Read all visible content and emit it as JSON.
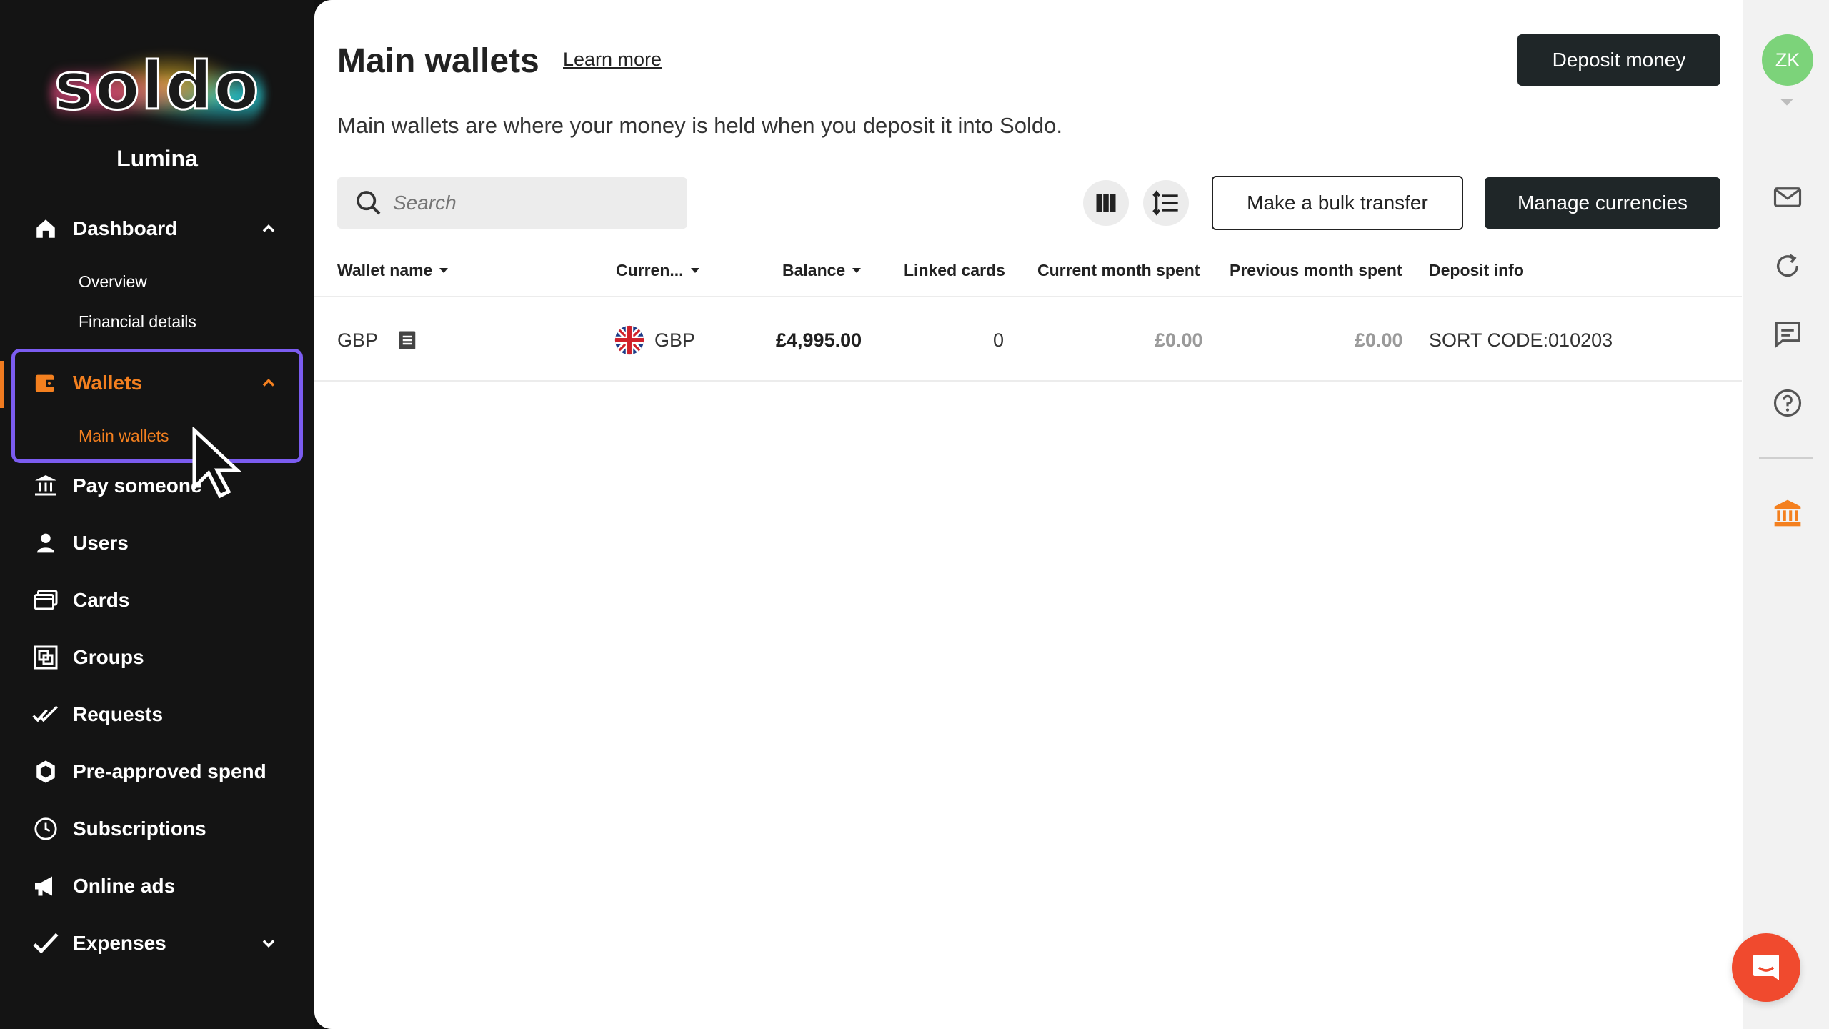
{
  "sidebar": {
    "logo_text": "soldo",
    "company_name": "Lumina",
    "nav": [
      {
        "label": "Dashboard",
        "icon": "home-icon",
        "expanded": true
      },
      {
        "label": "Wallets",
        "icon": "wallet-icon",
        "expanded": true,
        "active": true
      },
      {
        "label": "Pay someone",
        "icon": "bank-transfer-icon"
      },
      {
        "label": "Users",
        "icon": "user-icon"
      },
      {
        "label": "Cards",
        "icon": "cards-icon"
      },
      {
        "label": "Groups",
        "icon": "groups-icon"
      },
      {
        "label": "Requests",
        "icon": "double-check-icon"
      },
      {
        "label": "Pre-approved spend",
        "icon": "shield-hexagon-icon"
      },
      {
        "label": "Subscriptions",
        "icon": "clock-icon"
      },
      {
        "label": "Online ads",
        "icon": "megaphone-icon"
      },
      {
        "label": "Expenses",
        "icon": "check-icon",
        "expanded": false
      }
    ],
    "dashboard_sub": [
      "Overview",
      "Financial details"
    ],
    "wallets_sub": [
      "Main wallets"
    ]
  },
  "header": {
    "title": "Main wallets",
    "learn_more": "Learn more",
    "deposit_button": "Deposit money",
    "description": "Main wallets are where your money is held when you deposit it into Soldo."
  },
  "toolbar": {
    "search_placeholder": "Search",
    "bulk_transfer": "Make a bulk transfer",
    "manage_currencies": "Manage currencies"
  },
  "table": {
    "columns": [
      "Wallet name",
      "Curren...",
      "Balance",
      "Linked cards",
      "Current month spent",
      "Previous month spent",
      "Deposit info"
    ],
    "rows": [
      {
        "wallet_name": "GBP",
        "currency": "GBP",
        "balance": "£4,995.00",
        "linked_cards": "0",
        "current_month_spent": "£0.00",
        "previous_month_spent": "£0.00",
        "deposit_info": "SORT CODE:010203"
      }
    ]
  },
  "rail": {
    "avatar_initials": "ZK"
  },
  "colors": {
    "accent_orange": "#f4801f",
    "highlight_purple": "#7b5cf0",
    "avatar_green": "#7cd37a",
    "chat_red": "#f04a2e",
    "sidebar_bg": "#141414"
  }
}
